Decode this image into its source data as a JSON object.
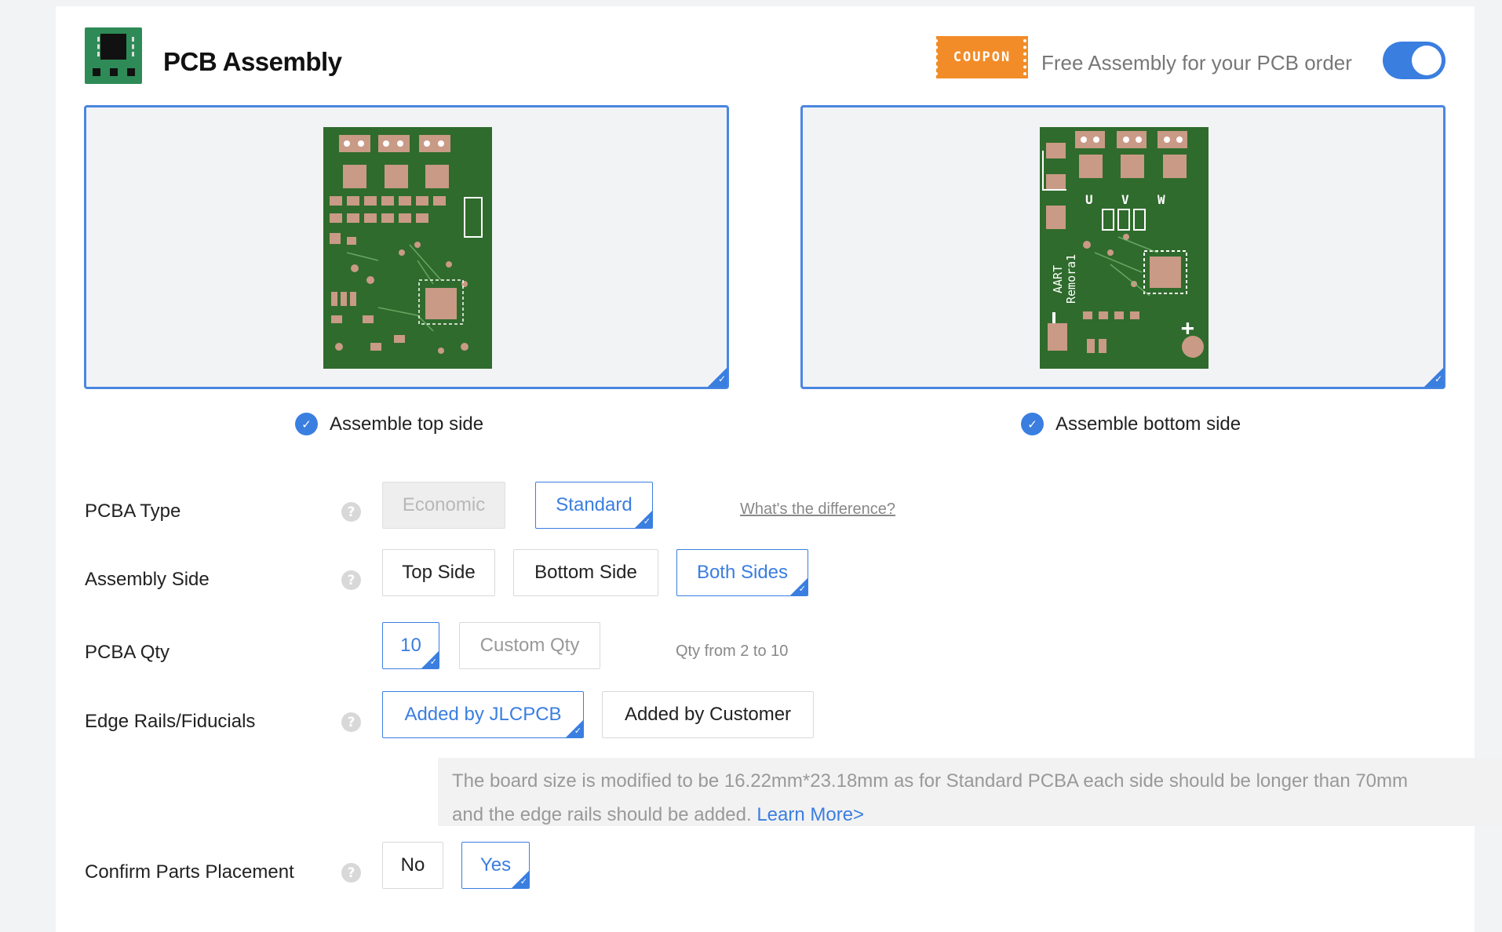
{
  "header": {
    "title": "PCB Assembly",
    "coupon_badge": "COUPON",
    "coupon_text": "Free Assembly for your PCB order",
    "toggle_on": true
  },
  "previews": {
    "top_label": "Assemble top side",
    "bottom_label": "Assemble bottom side",
    "bottom_silk": {
      "u": "U",
      "v": "V",
      "w": "W",
      "line1": "AART",
      "line2": "Remora1",
      "plus": "+"
    }
  },
  "pcba_type": {
    "label": "PCBA Type",
    "options": [
      "Economic",
      "Standard"
    ],
    "selected": "Standard",
    "link": "What's the difference?"
  },
  "assembly_side": {
    "label": "Assembly Side",
    "options": [
      "Top Side",
      "Bottom Side",
      "Both Sides"
    ],
    "selected": "Both Sides"
  },
  "pcba_qty": {
    "label": "PCBA Qty",
    "value": "10",
    "custom_placeholder": "Custom Qty",
    "hint": "Qty from 2 to 10"
  },
  "edge_rails": {
    "label": "Edge Rails/Fiducials",
    "options": [
      "Added by JLCPCB",
      "Added by Customer"
    ],
    "selected": "Added by JLCPCB",
    "notice_line1": "The board size is modified to be 16.22mm*23.18mm as for Standard PCBA each side should be longer than 70mm",
    "notice_line2": "and the edge rails should be added.",
    "learn_more": "Learn More>"
  },
  "confirm_placement": {
    "label": "Confirm Parts Placement",
    "options": [
      "No",
      "Yes"
    ],
    "selected": "Yes"
  },
  "colors": {
    "accent": "#3a7ee0",
    "coupon": "#f28c28",
    "pcb_green": "#2f6b2c",
    "pad": "#c99a86"
  }
}
